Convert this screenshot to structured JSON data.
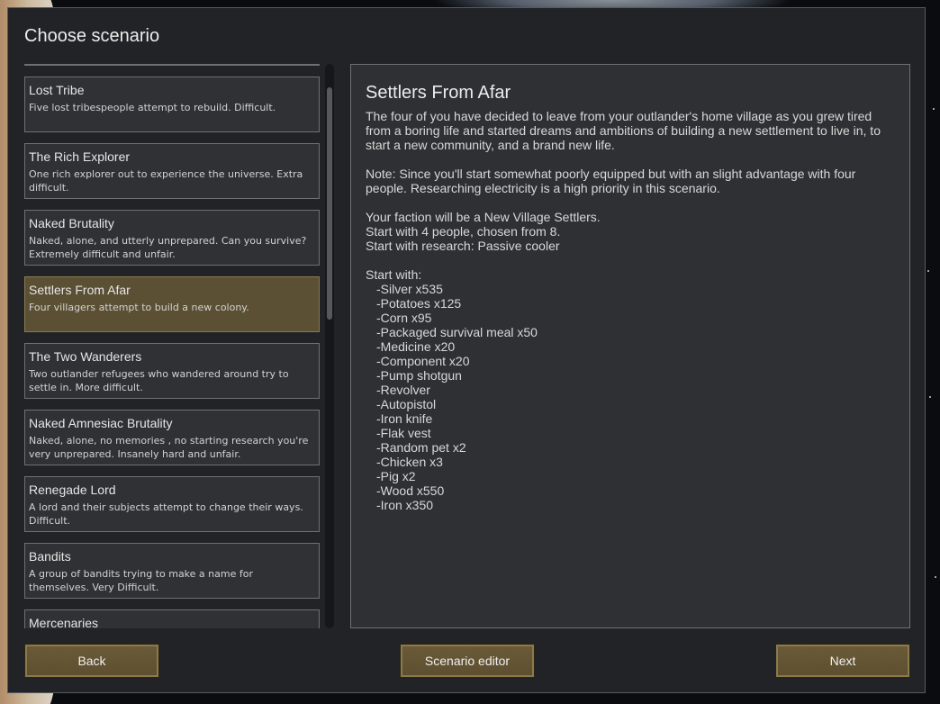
{
  "window": {
    "title": "Choose scenario"
  },
  "scenarios": [
    {
      "name": "Lost Tribe",
      "description": "Five lost tribespeople attempt to rebuild. Difficult."
    },
    {
      "name": "The Rich Explorer",
      "description": "One rich explorer out to experience the universe. Extra difficult."
    },
    {
      "name": "Naked Brutality",
      "description": "Naked, alone, and utterly unprepared. Can you survive? Extremely difficult and unfair."
    },
    {
      "name": "Settlers From Afar",
      "description": "Four villagers attempt to build a new colony.",
      "selected": true
    },
    {
      "name": "The Two Wanderers",
      "description": "Two outlander refugees who wandered around try to settle in. More difficult."
    },
    {
      "name": "Naked Amnesiac Brutality",
      "description": "Naked, alone, no memories , no starting research you're very unprepared. Insanely hard and unfair."
    },
    {
      "name": "Renegade Lord",
      "description": "A lord and their subjects attempt to change their ways. Difficult."
    },
    {
      "name": "Bandits",
      "description": "A group of bandits trying to make a name for themselves. Very Difficult."
    },
    {
      "name": "Mercenaries",
      "description": ""
    }
  ],
  "detail": {
    "title": "Settlers From Afar",
    "intro": "The four of you have decided to leave from your outlander's home village as you grew tired from a boring life and started dreams and ambitions of building a new settlement to live in, to start a new community, and a brand new life.",
    "note": "Note: Since you'll start somewhat poorly equipped but with an slight advantage with four people. Researching electricity is a high priority in this scenario.",
    "faction": "Your faction will be a New Village Settlers.",
    "people": "Start with 4 people, chosen from 8.",
    "research": "Start with research: Passive cooler",
    "start_with_label": "Start with:",
    "items": [
      "-Silver x535",
      "-Potatoes x125",
      "-Corn x95",
      "-Packaged survival meal x50",
      "-Medicine x20",
      "-Component x20",
      "-Pump shotgun",
      "-Revolver",
      "-Autopistol",
      "-Iron knife",
      "-Flak vest",
      "-Random pet x2",
      "-Chicken x3",
      "-Pig x2",
      "-Wood x550",
      "-Iron x350"
    ]
  },
  "buttons": {
    "back": "Back",
    "editor": "Scenario editor",
    "next": "Next"
  },
  "colors": {
    "window_bg": "#212326",
    "selected_item": "#5b5034",
    "button": "#6a5a38"
  }
}
